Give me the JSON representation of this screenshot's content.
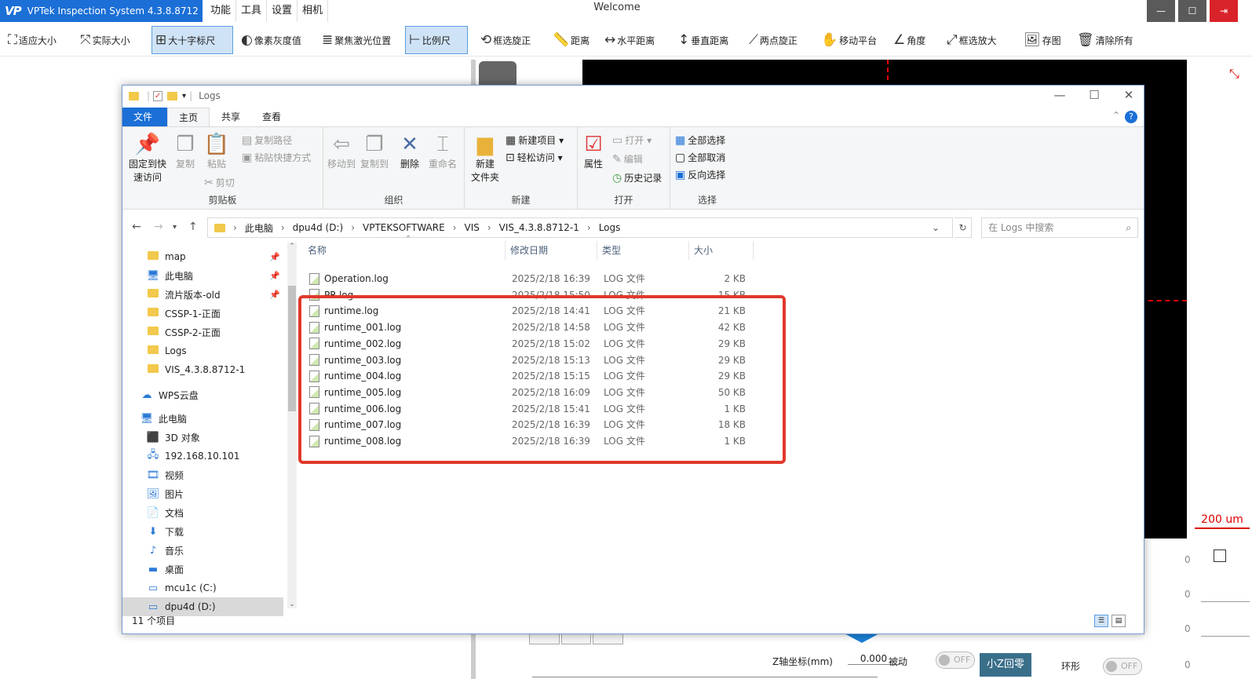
{
  "app": {
    "title": "VPTek Inspection System 4.3.8.8712",
    "logo_text": "VP",
    "menu": [
      "功能",
      "工具",
      "设置",
      "相机"
    ],
    "welcome": "Welcome",
    "accent": "#1b6fd6"
  },
  "toolbar": {
    "items": [
      {
        "label": "适应大小",
        "icon": "fit-icon"
      },
      {
        "label": "实际大小",
        "icon": "actual-size-icon"
      },
      {
        "label": "大十字标尺",
        "icon": "crosshair-icon",
        "active": true
      },
      {
        "label": "像素灰度值",
        "icon": "grayscale-icon"
      },
      {
        "label": "聚焦激光位置",
        "icon": "laser-icon"
      },
      {
        "label": "比例尺",
        "icon": "scale-icon",
        "active": true
      },
      {
        "label": "框选旋正",
        "icon": "rotate-select-icon"
      },
      {
        "label": "距离",
        "icon": "ruler-icon"
      },
      {
        "label": "水平距离",
        "icon": "horizontal-distance-icon"
      },
      {
        "label": "垂直距离",
        "icon": "vertical-distance-icon"
      },
      {
        "label": "两点旋正",
        "icon": "two-point-rotate-icon"
      },
      {
        "label": "移动平台",
        "icon": "hand-icon"
      },
      {
        "label": "角度",
        "icon": "angle-icon"
      },
      {
        "label": "框选放大",
        "icon": "zoom-select-icon"
      },
      {
        "label": "存图",
        "icon": "save-image-icon"
      },
      {
        "label": "清除所有",
        "icon": "trash-icon"
      }
    ]
  },
  "viewer": {
    "scale_label": "200 um"
  },
  "bottom": {
    "z_label": "Z轴坐标(mm)",
    "z_value": "0.000",
    "passive_label": "被动",
    "toggle_off": "OFF",
    "z_home_button": "小Z回零",
    "ring_label": "环形",
    "zeros": [
      "0",
      "0",
      "0",
      "0"
    ]
  },
  "explorer": {
    "title": "Logs",
    "tabs": {
      "file": "文件",
      "home": "主页",
      "share": "共享",
      "view": "查看"
    },
    "ribbon": {
      "pin": "固定到快速访问",
      "pin_l1": "固定到快",
      "pin_l2": "速访问",
      "copy": "复制",
      "paste": "粘贴",
      "copy_path": "复制路径",
      "paste_shortcut": "粘贴快捷方式",
      "cut": "剪切",
      "clipboard": "剪贴板",
      "move_to": "移动到",
      "copy_to": "复制到",
      "delete": "删除",
      "rename": "重命名",
      "organize": "组织",
      "new_folder_l1": "新建",
      "new_folder_l2": "文件夹",
      "new_item": "新建项目",
      "easy_access": "轻松访问",
      "new": "新建",
      "properties": "属性",
      "open": "打开",
      "edit": "编辑",
      "history": "历史记录",
      "open_group": "打开",
      "select_all": "全部选择",
      "select_none": "全部取消",
      "invert_select": "反向选择",
      "select_group": "选择"
    },
    "address": [
      "此电脑",
      "dpu4d (D:)",
      "VPTEKSOFTWARE",
      "VIS",
      "VIS_4.3.8.8712-1",
      "Logs"
    ],
    "search_placeholder": "在 Logs 中搜索",
    "nav": [
      {
        "label": "map",
        "icon": "folder-icon",
        "pinned": true
      },
      {
        "label": "此电脑",
        "icon": "monitor-icon",
        "pinned": true
      },
      {
        "label": "流片版本-old",
        "icon": "folder-icon",
        "pinned": true
      },
      {
        "label": "CSSP-1-正面",
        "icon": "folder-icon"
      },
      {
        "label": "CSSP-2-正面",
        "icon": "folder-icon"
      },
      {
        "label": "Logs",
        "icon": "folder-icon"
      },
      {
        "label": "VIS_4.3.8.8712-1",
        "icon": "folder-icon"
      },
      {
        "label": "WPS云盘",
        "icon": "cloud-icon"
      },
      {
        "label": "此电脑",
        "icon": "monitor-icon"
      },
      {
        "label": "3D 对象",
        "icon": "cube-icon"
      },
      {
        "label": "192.168.10.101",
        "icon": "network-icon"
      },
      {
        "label": "视频",
        "icon": "video-icon"
      },
      {
        "label": "图片",
        "icon": "picture-icon"
      },
      {
        "label": "文档",
        "icon": "document-icon"
      },
      {
        "label": "下载",
        "icon": "download-icon"
      },
      {
        "label": "音乐",
        "icon": "music-icon"
      },
      {
        "label": "桌面",
        "icon": "desktop-icon"
      },
      {
        "label": "mcu1c (C:)",
        "icon": "drive-icon"
      },
      {
        "label": "dpu4d (D:)",
        "icon": "drive-icon",
        "selected": true
      }
    ],
    "columns": [
      "名称",
      "修改日期",
      "类型",
      "大小"
    ],
    "files": [
      {
        "name": "Operation.log",
        "date": "2025/2/18 16:39",
        "type": "LOG 文件",
        "size": "2 KB"
      },
      {
        "name": "PR.log",
        "date": "2025/2/18 15:50",
        "type": "LOG 文件",
        "size": "15 KB"
      },
      {
        "name": "runtime.log",
        "date": "2025/2/18 14:41",
        "type": "LOG 文件",
        "size": "21 KB"
      },
      {
        "name": "runtime_001.log",
        "date": "2025/2/18 14:58",
        "type": "LOG 文件",
        "size": "42 KB"
      },
      {
        "name": "runtime_002.log",
        "date": "2025/2/18 15:02",
        "type": "LOG 文件",
        "size": "29 KB"
      },
      {
        "name": "runtime_003.log",
        "date": "2025/2/18 15:13",
        "type": "LOG 文件",
        "size": "29 KB"
      },
      {
        "name": "runtime_004.log",
        "date": "2025/2/18 15:15",
        "type": "LOG 文件",
        "size": "29 KB"
      },
      {
        "name": "runtime_005.log",
        "date": "2025/2/18 16:09",
        "type": "LOG 文件",
        "size": "50 KB"
      },
      {
        "name": "runtime_006.log",
        "date": "2025/2/18 15:41",
        "type": "LOG 文件",
        "size": "1 KB"
      },
      {
        "name": "runtime_007.log",
        "date": "2025/2/18 16:39",
        "type": "LOG 文件",
        "size": "18 KB"
      },
      {
        "name": "runtime_008.log",
        "date": "2025/2/18 16:39",
        "type": "LOG 文件",
        "size": "1 KB"
      }
    ],
    "status": "11 个项目",
    "highlight_color": "#e0392c"
  }
}
